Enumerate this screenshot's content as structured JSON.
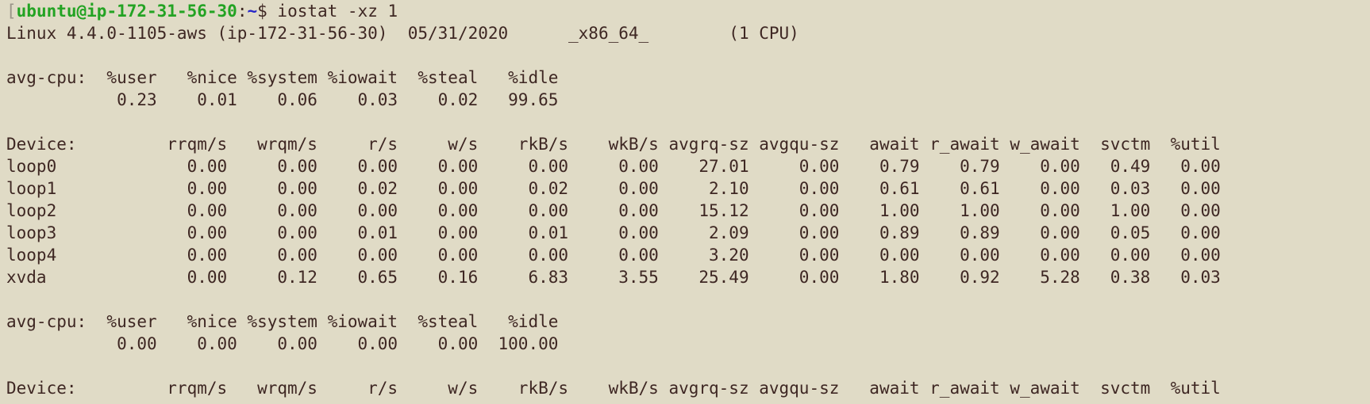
{
  "prompt": {
    "bracket": "[",
    "user_host": "ubuntu@ip-172-31-56-30",
    "colon": ":",
    "path": "~",
    "dollar": "$ ",
    "command": "iostat -xz 1"
  },
  "system_info": "Linux 4.4.0-1105-aws (ip-172-31-56-30)  05/31/2020      _x86_64_        (1 CPU)",
  "blocks": [
    {
      "cpu_header": "avg-cpu:  %user   %nice %system %iowait  %steal   %idle",
      "cpu_values": "           0.23    0.01    0.06    0.03    0.02   99.65",
      "device_header": "Device:         rrqm/s   wrqm/s     r/s     w/s    rkB/s    wkB/s avgrq-sz avgqu-sz   await r_await w_await  svctm  %util",
      "devices": [
        "loop0             0.00     0.00    0.00    0.00     0.00     0.00    27.01     0.00    0.79    0.79    0.00   0.49   0.00",
        "loop1             0.00     0.00    0.02    0.00     0.02     0.00     2.10     0.00    0.61    0.61    0.00   0.03   0.00",
        "loop2             0.00     0.00    0.00    0.00     0.00     0.00    15.12     0.00    1.00    1.00    0.00   1.00   0.00",
        "loop3             0.00     0.00    0.01    0.00     0.01     0.00     2.09     0.00    0.89    0.89    0.00   0.05   0.00",
        "loop4             0.00     0.00    0.00    0.00     0.00     0.00     3.20     0.00    0.00    0.00    0.00   0.00   0.00",
        "xvda              0.00     0.12    0.65    0.16     6.83     3.55    25.49     0.00    1.80    0.92    5.28   0.38   0.03"
      ]
    },
    {
      "cpu_header": "avg-cpu:  %user   %nice %system %iowait  %steal   %idle",
      "cpu_values": "           0.00    0.00    0.00    0.00    0.00  100.00",
      "device_header": "Device:         rrqm/s   wrqm/s     r/s     w/s    rkB/s    wkB/s avgrq-sz avgqu-sz   await r_await w_await  svctm  %util",
      "devices": []
    }
  ],
  "colors": {
    "background": "#e0dbc6",
    "text": "#3e2723",
    "prompt_user": "#23a323",
    "prompt_path": "#2626c8"
  }
}
